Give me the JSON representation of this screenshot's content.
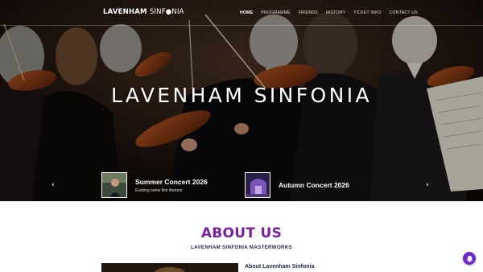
{
  "header": {
    "logo_bold": "LAVENHAM",
    "logo_light": "SINF",
    "logo_rest": "NIA",
    "menu": [
      {
        "label": "HOME",
        "active": true
      },
      {
        "label": "PROGRAMME",
        "active": false
      },
      {
        "label": "FRIENDS",
        "active": false
      },
      {
        "label": "HISTORY",
        "active": false
      },
      {
        "label": "TICKET INFO",
        "active": false
      },
      {
        "label": "CONTACT US",
        "active": false
      }
    ]
  },
  "hero": {
    "title": "LAVENHAM SINFONIA",
    "prev_icon": "chevron-left-icon",
    "next_icon": "chevron-right-icon",
    "slides": [
      {
        "title": "Summer Concert 2026",
        "subtitle": "Evoking some film themes"
      },
      {
        "title": "Autumn Concert 2026",
        "subtitle": ""
      }
    ]
  },
  "about": {
    "heading": "ABOUT US",
    "subheading": "LAVENHAM SINFONIA MASTERWORKS",
    "column_title": "About Lavenham Sinfonia"
  },
  "floating_button": {
    "icon": "bell-icon"
  },
  "colors": {
    "accent": "#7b1fa2",
    "navy": "#1f2a44",
    "fab": "#6f2bc7"
  }
}
